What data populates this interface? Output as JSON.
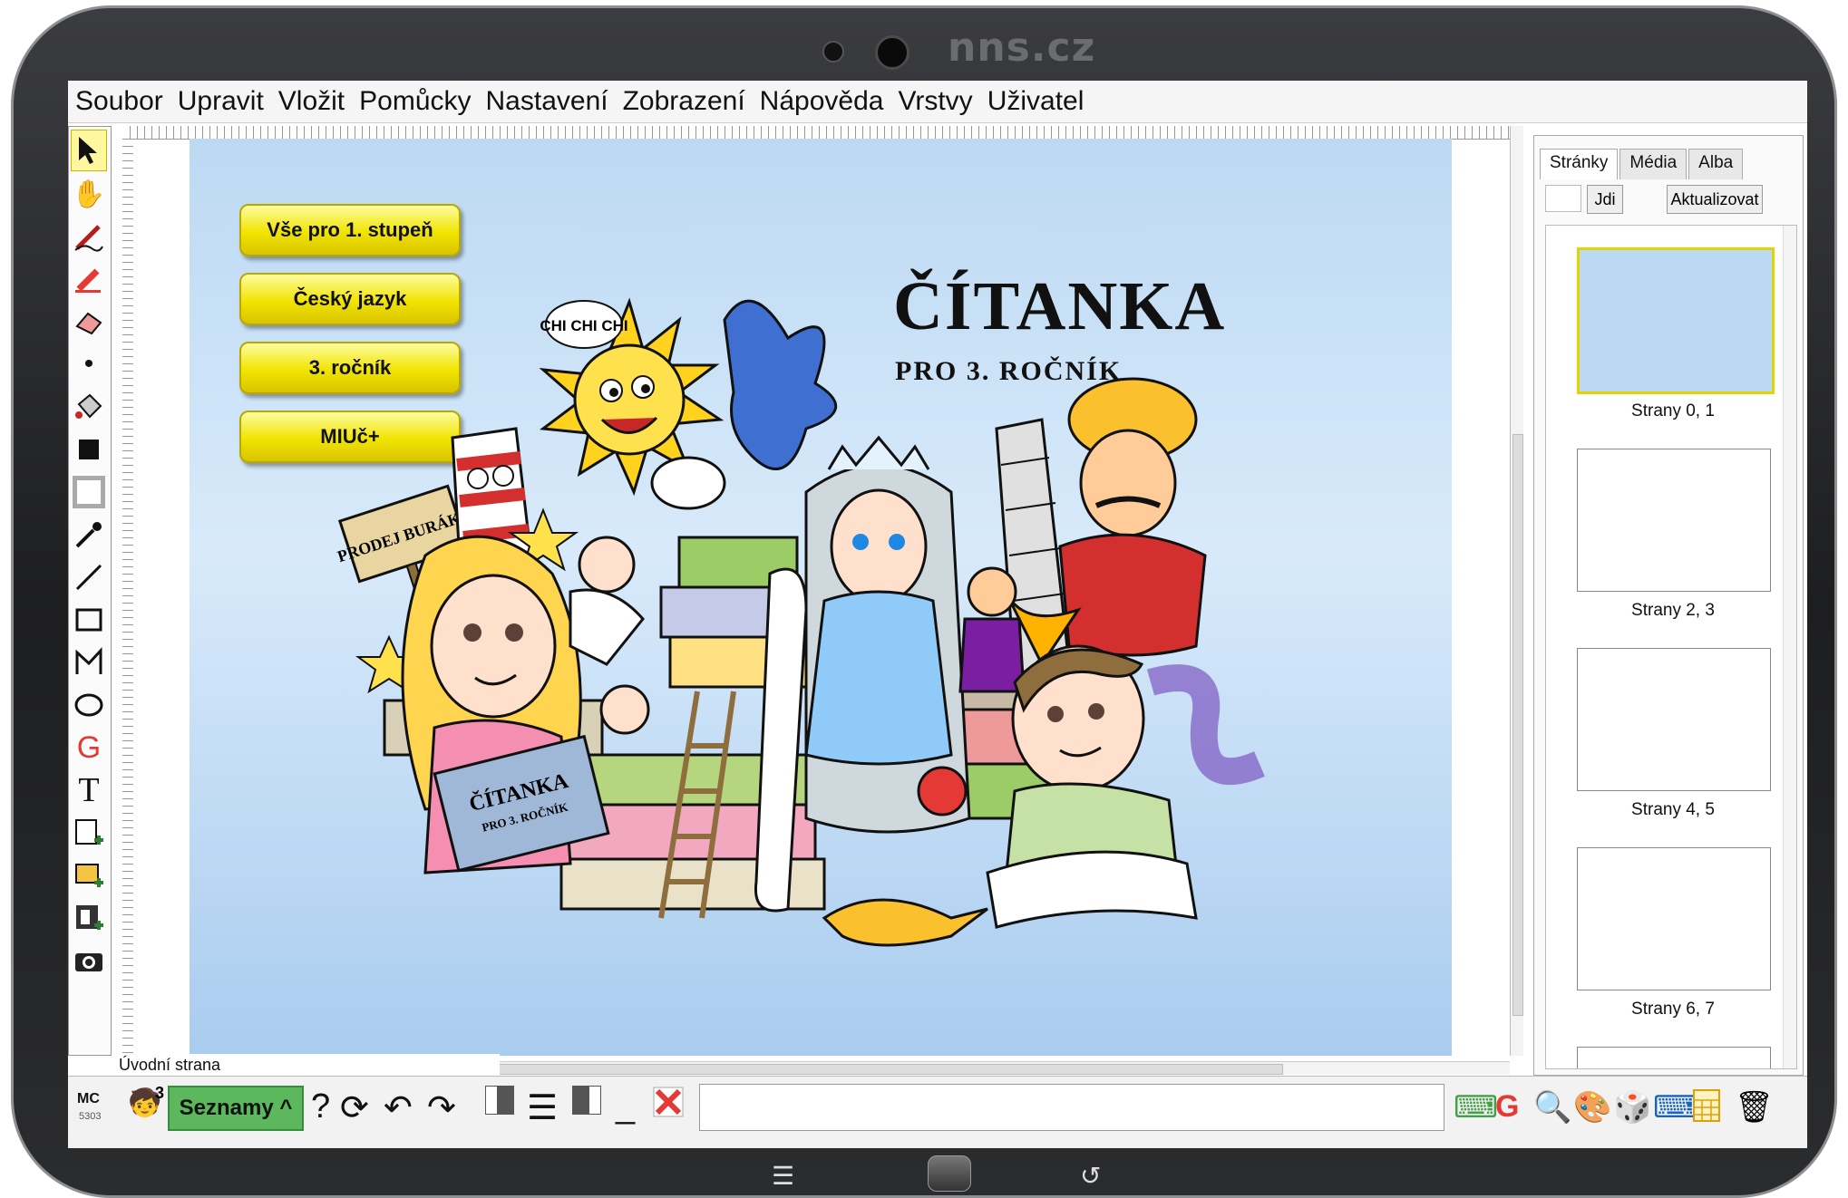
{
  "device": {
    "brand": "nns.cz"
  },
  "menu": [
    "Soubor",
    "Upravit",
    "Vložit",
    "Pomůcky",
    "Nastavení",
    "Zobrazení",
    "Nápověda",
    "Vrstvy",
    "Uživatel"
  ],
  "toolbar_icons": [
    "arrow-pointer-icon",
    "hand-icon",
    "pen-icon",
    "marker-icon",
    "eraser-icon",
    "dot-icon",
    "fill-bucket-icon",
    "black-square-icon",
    "gray-square-icon",
    "eyedropper-icon",
    "line-icon",
    "rectangle-icon",
    "polygon-icon",
    "ellipse-icon",
    "g-icon",
    "text-icon",
    "add-note-icon",
    "add-image-icon",
    "add-media-icon",
    "camera-icon"
  ],
  "page": {
    "buttons": [
      "Vše pro 1. stupeň",
      "Český jazyk",
      "3. ročník",
      "MIUč+"
    ],
    "title": "ČÍTANKA",
    "subtitle": "PRO 3. ROČNÍK",
    "sign_text": "PRODEJ BURÁKŮ",
    "bubble_text": "CHI CHI CHI",
    "book_title": "ČÍTANKA",
    "book_subtitle": "PRO 3. ROČNÍK"
  },
  "status": {
    "page_name": "Úvodní strana"
  },
  "side_panel": {
    "tabs": [
      "Stránky",
      "Média",
      "Alba"
    ],
    "active_tab": "Stránky",
    "go_button": "Jdi",
    "refresh_button": "Aktualizovat",
    "thumbnails": [
      "Strany 0, 1",
      "Strany 2, 3",
      "Strany 4, 5",
      "Strany 6, 7"
    ]
  },
  "bottom": {
    "mc_label": "MC",
    "mc_number": "5303",
    "badge": "3",
    "lists_button": "Seznamy ^"
  },
  "colors": {
    "button_yellow": "#f1e400",
    "canvas_blue": "#bcd9f3",
    "lists_green": "#5cb85c"
  }
}
